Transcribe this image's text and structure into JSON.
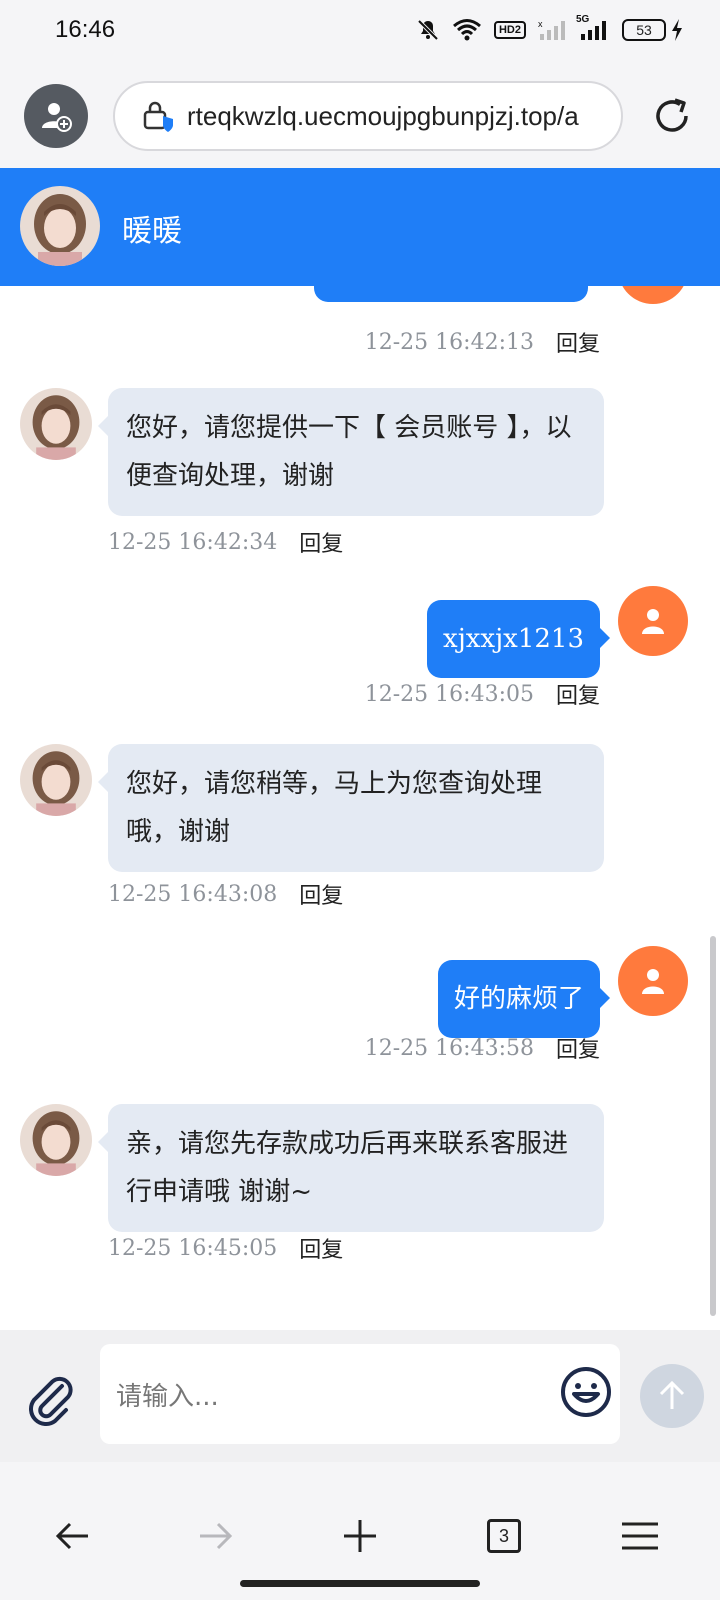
{
  "status_bar": {
    "time": "16:46",
    "icons": [
      "mute-bell-icon",
      "wifi-icon",
      "hd-badge",
      "signal-off-icon",
      "signal-5g-icon",
      "battery-icon",
      "charging-bolt-icon"
    ],
    "hd_label": "HD2",
    "network_label": "5G",
    "battery_level": "53"
  },
  "browser": {
    "url": "rteqkwzlq.uecmoujpgbunpjzj.top/a",
    "icons": {
      "profile": "person-add-icon",
      "security": "shield-lock-icon",
      "reload": "reload-icon"
    }
  },
  "chat_header": {
    "name": "暖暖",
    "color": "#1f7ef7"
  },
  "messages": [
    {
      "from": "user",
      "text": "",
      "time": "12-25 16:42:13",
      "reply": "回复",
      "partial": true
    },
    {
      "from": "agent",
      "text": "您好，请您提供一下【 会员账号 】，以便查询处理，谢谢",
      "time": "12-25 16:42:34",
      "reply": "回复"
    },
    {
      "from": "user",
      "text": "xjxxjx1213",
      "time": "12-25 16:43:05",
      "reply": "回复"
    },
    {
      "from": "agent",
      "text": "您好，请您稍等，马上为您查询处理哦，谢谢",
      "time": "12-25 16:43:08",
      "reply": "回复"
    },
    {
      "from": "user",
      "text": "好的麻烦了",
      "time": "12-25 16:43:58",
      "reply": "回复"
    },
    {
      "from": "agent",
      "text": "亲，请您先存款成功后再来联系客服进行申请哦 谢谢~",
      "time": "12-25 16:45:05",
      "reply": "回复"
    }
  ],
  "input_bar": {
    "placeholder": "请输入...",
    "icons": {
      "attach": "paperclip-icon",
      "emoji": "smiley-icon",
      "send": "arrow-up-icon"
    }
  },
  "bottom_nav": {
    "tab_count": "3",
    "icons": [
      "back-arrow-icon",
      "forward-arrow-icon",
      "plus-icon",
      "tabs-icon",
      "menu-icon"
    ]
  },
  "colors": {
    "accent": "#1f7ef7",
    "user_avatar": "#ff7a3d",
    "agent_bubble": "#e4eaf3"
  }
}
